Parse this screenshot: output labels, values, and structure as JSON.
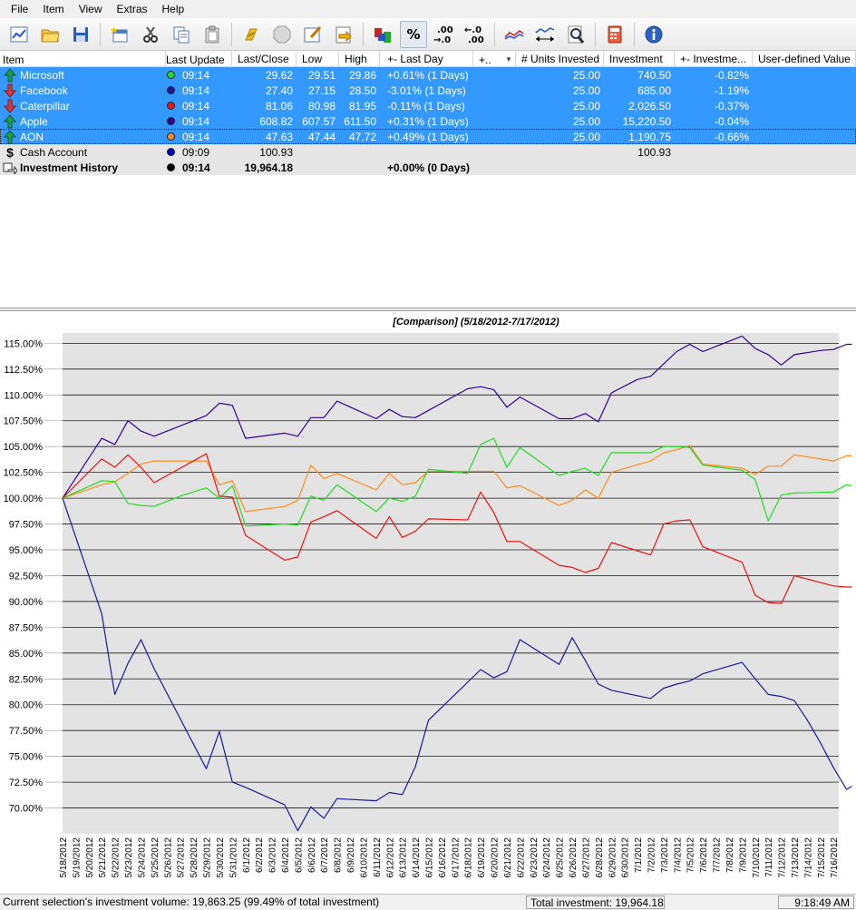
{
  "menu": [
    "File",
    "Item",
    "View",
    "Extras",
    "Help"
  ],
  "toolbar": {
    "buttons": [
      {
        "name": "chart-icon"
      },
      {
        "name": "open-folder-icon"
      },
      {
        "name": "save-icon"
      },
      {
        "name": "new-item-icon"
      },
      {
        "name": "cut-icon"
      },
      {
        "name": "copy-icon"
      },
      {
        "name": "paste-icon"
      },
      {
        "name": "link-icon"
      },
      {
        "name": "delete-icon"
      },
      {
        "name": "edit-icon"
      },
      {
        "name": "import-icon"
      },
      {
        "name": "transfer-icon"
      }
    ],
    "percent_label": "%",
    "inc_decimals_label": ".00\n→.0",
    "dec_decimals_label": "←.0\n.00",
    "comparison_label": "compare",
    "zoom_label": "zoom",
    "calculator_label": "calc",
    "info_label": "info"
  },
  "table": {
    "columns": [
      "Item",
      "Last Update",
      "Last/Close",
      "Low",
      "High",
      "+- Last Day",
      "+..",
      "# Units Invested",
      "Investment",
      "+- Investme...",
      "User-defined Value"
    ],
    "rows": [
      {
        "name": "Microsoft",
        "dir": "up",
        "color": "#22dd22",
        "time": "09:14",
        "close": "29.62",
        "low": "29.51",
        "high": "29.86",
        "last": "+0.61% (1 Days)",
        "units": "25.00",
        "investment": "740.50",
        "inv_pct": "-0.82%",
        "style": "sel"
      },
      {
        "name": "Facebook",
        "dir": "down",
        "color": "#1a1a9a",
        "time": "09:14",
        "close": "27.40",
        "low": "27.15",
        "high": "28.50",
        "last": "-3.01% (1 Days)",
        "units": "25.00",
        "investment": "685.00",
        "inv_pct": "-1.19%",
        "style": "sel"
      },
      {
        "name": "Caterpillar",
        "dir": "down",
        "color": "#ee1111",
        "time": "09:14",
        "close": "81.06",
        "low": "80.98",
        "high": "81.95",
        "last": "-0.11% (1 Days)",
        "units": "25.00",
        "investment": "2,026.50",
        "inv_pct": "-0.37%",
        "style": "sel"
      },
      {
        "name": "Apple",
        "dir": "up",
        "color": "#330099",
        "time": "09:14",
        "close": "608.82",
        "low": "607.57",
        "high": "611.50",
        "last": "+0.31% (1 Days)",
        "units": "25.00",
        "investment": "15,220.50",
        "inv_pct": "-0.04%",
        "style": "sel"
      },
      {
        "name": "AON",
        "dir": "up",
        "color": "#ff8c1a",
        "time": "09:14",
        "close": "47.63",
        "low": "47.44",
        "high": "47.72",
        "last": "+0.49% (1 Days)",
        "units": "25.00",
        "investment": "1,190.75",
        "inv_pct": "-0.66%",
        "style": "sel focus"
      },
      {
        "name": "Cash Account",
        "dir": "cash",
        "color": "#0000cc",
        "time": "09:09",
        "close": "100.93",
        "low": "",
        "high": "",
        "last": "",
        "units": "",
        "investment": "100.93",
        "inv_pct": "",
        "style": "cash"
      },
      {
        "name": "Investment History",
        "dir": "hist",
        "color": "#000000",
        "time": "09:14",
        "close": "19,964.18",
        "low": "",
        "high": "",
        "last": "+0.00% (0 Days)",
        "units": "",
        "investment": "",
        "inv_pct": "",
        "style": "hist"
      }
    ]
  },
  "chart_data": {
    "type": "line",
    "title": "[Comparison] (5/18/2012-7/17/2012)",
    "ylim": [
      67.5,
      116
    ],
    "yticks": [
      70,
      72.5,
      75,
      77.5,
      80,
      82.5,
      85,
      87.5,
      90,
      92.5,
      95,
      97.5,
      100,
      102.5,
      105,
      107.5,
      110,
      112.5,
      115
    ],
    "ytick_format": "%",
    "grid": true,
    "x": [
      "5/18/2012",
      "5/19/2012",
      "5/20/2012",
      "5/21/2012",
      "5/22/2012",
      "5/23/2012",
      "5/24/2012",
      "5/25/2012",
      "5/26/2012",
      "5/27/2012",
      "5/28/2012",
      "5/29/2012",
      "5/30/2012",
      "5/31/2012",
      "6/1/2012",
      "6/2/2012",
      "6/3/2012",
      "6/4/2012",
      "6/5/2012",
      "6/6/2012",
      "6/7/2012",
      "6/8/2012",
      "6/9/2012",
      "6/10/2012",
      "6/11/2012",
      "6/12/2012",
      "6/13/2012",
      "6/14/2012",
      "6/15/2012",
      "6/16/2012",
      "6/17/2012",
      "6/18/2012",
      "6/19/2012",
      "6/20/2012",
      "6/21/2012",
      "6/22/2012",
      "6/23/2012",
      "6/24/2012",
      "6/25/2012",
      "6/26/2012",
      "6/27/2012",
      "6/28/2012",
      "6/29/2012",
      "6/30/2012",
      "7/1/2012",
      "7/2/2012",
      "7/3/2012",
      "7/4/2012",
      "7/5/2012",
      "7/6/2012",
      "7/7/2012",
      "7/8/2012",
      "7/9/2012",
      "7/10/2012",
      "7/11/2012",
      "7/12/2012",
      "7/13/2012",
      "7/14/2012",
      "7/15/2012",
      "7/16/2012"
    ],
    "series": [
      {
        "name": "Apple",
        "color": "#330099",
        "points": [
          [
            0,
            100.0
          ],
          [
            3,
            105.8
          ],
          [
            4,
            105.2
          ],
          [
            5,
            107.5
          ],
          [
            6,
            106.5
          ],
          [
            7,
            106.0
          ],
          [
            11,
            108.0
          ],
          [
            12,
            109.2
          ],
          [
            13,
            109.0
          ],
          [
            14,
            105.8
          ],
          [
            17,
            106.3
          ],
          [
            18,
            106.0
          ],
          [
            19,
            107.8
          ],
          [
            20,
            107.8
          ],
          [
            21,
            109.4
          ],
          [
            24,
            107.7
          ],
          [
            25,
            108.6
          ],
          [
            26,
            107.9
          ],
          [
            27,
            107.8
          ],
          [
            31,
            110.6
          ],
          [
            32,
            110.8
          ],
          [
            33,
            110.5
          ],
          [
            34,
            108.8
          ],
          [
            35,
            109.8
          ],
          [
            38,
            107.7
          ],
          [
            39,
            107.7
          ],
          [
            40,
            108.2
          ],
          [
            41,
            107.4
          ],
          [
            42,
            110.2
          ],
          [
            44,
            111.5
          ],
          [
            45,
            111.8
          ],
          [
            46,
            113.0
          ],
          [
            47,
            114.2
          ],
          [
            48,
            114.9
          ],
          [
            49,
            114.2
          ],
          [
            52,
            115.7
          ],
          [
            53,
            114.5
          ],
          [
            54,
            113.9
          ],
          [
            55,
            112.9
          ],
          [
            56,
            113.9
          ],
          [
            58,
            114.3
          ],
          [
            59,
            114.4
          ],
          [
            60,
            114.9
          ],
          [
            60.4,
            114.9
          ]
        ]
      },
      {
        "name": "AON",
        "color": "#ff8c1a",
        "points": [
          [
            0,
            100.0
          ],
          [
            3,
            101.3
          ],
          [
            4,
            101.6
          ],
          [
            5,
            102.4
          ],
          [
            6,
            103.3
          ],
          [
            7,
            103.6
          ],
          [
            11,
            103.6
          ],
          [
            12,
            101.3
          ],
          [
            13,
            101.7
          ],
          [
            14,
            98.7
          ],
          [
            17,
            99.2
          ],
          [
            18,
            99.8
          ],
          [
            19,
            103.2
          ],
          [
            20,
            101.9
          ],
          [
            21,
            102.4
          ],
          [
            24,
            100.8
          ],
          [
            25,
            102.4
          ],
          [
            26,
            101.3
          ],
          [
            27,
            101.5
          ],
          [
            28,
            102.6
          ],
          [
            32,
            102.6
          ],
          [
            33,
            102.6
          ],
          [
            34,
            101.0
          ],
          [
            35,
            101.2
          ],
          [
            38,
            99.3
          ],
          [
            39,
            99.8
          ],
          [
            40,
            100.8
          ],
          [
            41,
            100.0
          ],
          [
            42,
            102.5
          ],
          [
            45,
            103.6
          ],
          [
            46,
            104.4
          ],
          [
            47,
            104.7
          ],
          [
            48,
            105.1
          ],
          [
            49,
            103.3
          ],
          [
            52,
            102.9
          ],
          [
            53,
            102.3
          ],
          [
            54,
            103.1
          ],
          [
            55,
            103.1
          ],
          [
            56,
            104.2
          ],
          [
            59,
            103.6
          ],
          [
            60,
            104.1
          ],
          [
            60.4,
            104.1
          ]
        ]
      },
      {
        "name": "Microsoft",
        "color": "#22dd22",
        "points": [
          [
            0,
            100.0
          ],
          [
            3,
            101.7
          ],
          [
            4,
            101.6
          ],
          [
            5,
            99.5
          ],
          [
            6,
            99.3
          ],
          [
            7,
            99.2
          ],
          [
            9,
            100.2
          ],
          [
            11,
            101.0
          ],
          [
            12,
            100.0
          ],
          [
            13,
            101.2
          ],
          [
            14,
            97.3
          ],
          [
            17,
            97.5
          ],
          [
            18,
            97.4
          ],
          [
            19,
            100.2
          ],
          [
            20,
            99.8
          ],
          [
            21,
            101.3
          ],
          [
            24,
            98.7
          ],
          [
            25,
            100.0
          ],
          [
            26,
            99.7
          ],
          [
            27,
            100.2
          ],
          [
            28,
            102.8
          ],
          [
            31,
            102.4
          ],
          [
            32,
            105.2
          ],
          [
            33,
            105.8
          ],
          [
            34,
            103.0
          ],
          [
            35,
            104.9
          ],
          [
            38,
            102.2
          ],
          [
            39,
            102.6
          ],
          [
            40,
            102.9
          ],
          [
            41,
            102.2
          ],
          [
            42,
            104.4
          ],
          [
            45,
            104.4
          ],
          [
            46,
            105.0
          ],
          [
            47,
            105.0
          ],
          [
            48,
            104.9
          ],
          [
            49,
            103.2
          ],
          [
            52,
            102.7
          ],
          [
            53,
            101.8
          ],
          [
            54,
            97.8
          ],
          [
            55,
            100.3
          ],
          [
            56,
            100.5
          ],
          [
            59,
            100.6
          ],
          [
            60,
            101.3
          ],
          [
            60.4,
            101.2
          ]
        ]
      },
      {
        "name": "Caterpillar",
        "color": "#ee1111",
        "points": [
          [
            0,
            100.0
          ],
          [
            3,
            103.8
          ],
          [
            4,
            103.0
          ],
          [
            5,
            104.2
          ],
          [
            6,
            103.0
          ],
          [
            7,
            101.5
          ],
          [
            11,
            104.3
          ],
          [
            12,
            100.2
          ],
          [
            13,
            100.1
          ],
          [
            14,
            96.4
          ],
          [
            17,
            94.0
          ],
          [
            18,
            94.3
          ],
          [
            19,
            97.7
          ],
          [
            20,
            98.2
          ],
          [
            21,
            98.8
          ],
          [
            24,
            96.1
          ],
          [
            25,
            98.2
          ],
          [
            26,
            96.2
          ],
          [
            27,
            96.8
          ],
          [
            28,
            98.0
          ],
          [
            31,
            97.9
          ],
          [
            32,
            100.6
          ],
          [
            33,
            98.6
          ],
          [
            34,
            95.8
          ],
          [
            35,
            95.8
          ],
          [
            38,
            93.5
          ],
          [
            39,
            93.3
          ],
          [
            40,
            92.8
          ],
          [
            41,
            93.2
          ],
          [
            42,
            95.7
          ],
          [
            45,
            94.5
          ],
          [
            46,
            97.5
          ],
          [
            47,
            97.8
          ],
          [
            48,
            97.9
          ],
          [
            49,
            95.3
          ],
          [
            52,
            93.8
          ],
          [
            53,
            90.6
          ],
          [
            54,
            89.9
          ],
          [
            55,
            89.8
          ],
          [
            56,
            92.5
          ],
          [
            59,
            91.5
          ],
          [
            60,
            91.4
          ],
          [
            60.4,
            91.4
          ]
        ]
      },
      {
        "name": "Facebook",
        "color": "#1a1a9a",
        "points": [
          [
            0,
            100.0
          ],
          [
            3,
            88.8
          ],
          [
            4,
            81.0
          ],
          [
            5,
            84.0
          ],
          [
            6,
            86.3
          ],
          [
            7,
            83.5
          ],
          [
            11,
            73.8
          ],
          [
            12,
            77.4
          ],
          [
            13,
            72.5
          ],
          [
            14,
            72.0
          ],
          [
            17,
            70.3
          ],
          [
            18,
            67.8
          ],
          [
            19,
            70.1
          ],
          [
            20,
            69.0
          ],
          [
            21,
            70.9
          ],
          [
            24,
            70.7
          ],
          [
            25,
            71.5
          ],
          [
            26,
            71.3
          ],
          [
            27,
            74.0
          ],
          [
            28,
            78.5
          ],
          [
            32,
            83.4
          ],
          [
            33,
            82.6
          ],
          [
            34,
            83.2
          ],
          [
            35,
            86.3
          ],
          [
            38,
            83.9
          ],
          [
            39,
            86.5
          ],
          [
            40,
            84.3
          ],
          [
            41,
            82.0
          ],
          [
            42,
            81.4
          ],
          [
            45,
            80.6
          ],
          [
            46,
            81.6
          ],
          [
            47,
            82.0
          ],
          [
            48,
            82.3
          ],
          [
            49,
            83.0
          ],
          [
            52,
            84.1
          ],
          [
            53,
            82.5
          ],
          [
            54,
            81.0
          ],
          [
            55,
            80.8
          ],
          [
            56,
            80.4
          ],
          [
            57,
            78.5
          ],
          [
            58,
            76.3
          ],
          [
            59,
            73.9
          ],
          [
            60,
            71.8
          ],
          [
            60.4,
            72.1
          ]
        ]
      }
    ]
  },
  "status": {
    "left": "Current selection's investment volume: 19,863.25 (99.49% of total investment)",
    "total": "Total investment: 19,964.18",
    "time": "9:18:49 AM"
  }
}
